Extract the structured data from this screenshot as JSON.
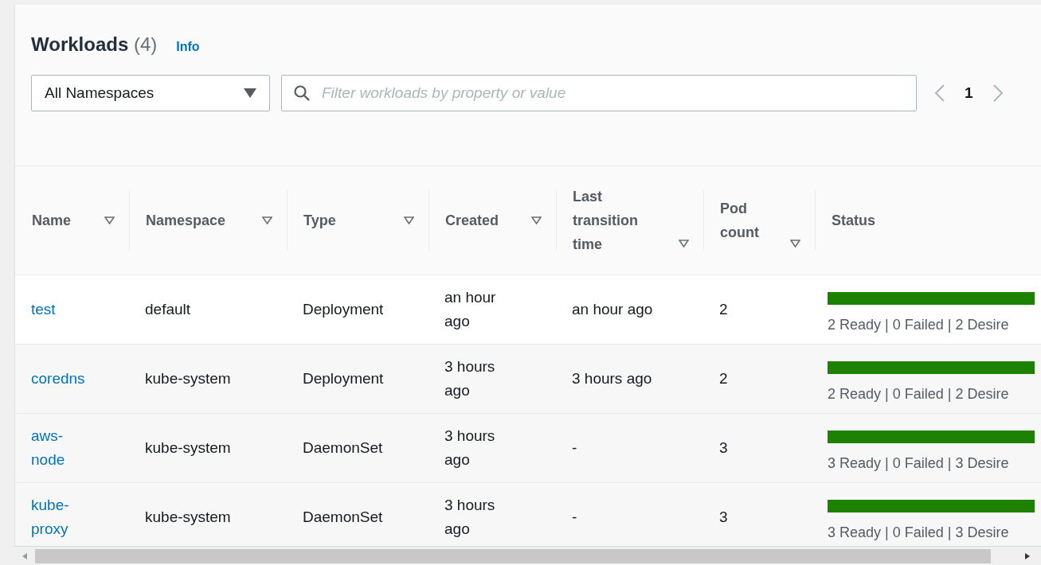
{
  "header": {
    "title": "Workloads",
    "count": "(4)",
    "info_link": "Info"
  },
  "namespace_select": {
    "value": "All Namespaces"
  },
  "search": {
    "placeholder": "Filter workloads by property or value"
  },
  "pagination": {
    "current_page": "1"
  },
  "table": {
    "columns": [
      {
        "label": "Name",
        "sortable": true
      },
      {
        "label": "Namespace",
        "sortable": true
      },
      {
        "label": "Type",
        "sortable": true
      },
      {
        "label": "Created",
        "sortable": true
      },
      {
        "label": "Last transition time",
        "sortable": true
      },
      {
        "label": "Pod count",
        "sortable": true
      },
      {
        "label": "Status",
        "sortable": false
      }
    ],
    "rows": [
      {
        "name": "test",
        "namespace": "default",
        "type": "Deployment",
        "created": "an hour ago",
        "last_transition": "an hour ago",
        "pod_count": "2",
        "level": 1,
        "status": "2 Ready | 0 Failed | 2 Desire"
      },
      {
        "name": "coredns",
        "namespace": "kube-system",
        "type": "Deployment",
        "created": "3 hours ago",
        "last_transition": "3 hours ago",
        "pod_count": "2",
        "level": 1,
        "status": "2 Ready | 0 Failed | 2 Desire"
      },
      {
        "name": "aws-node",
        "namespace": "kube-system",
        "type": "DaemonSet",
        "created": "3 hours ago",
        "last_transition": "-",
        "pod_count": "3",
        "level": 1,
        "status": "3 Ready | 0 Failed | 3 Desire"
      },
      {
        "name": "kube-proxy",
        "namespace": "kube-system",
        "type": "DaemonSet",
        "created": "3 hours ago",
        "last_transition": "-",
        "pod_count": "3",
        "level": 1,
        "status": "3 Ready | 0 Failed | 3 Desire"
      }
    ]
  }
}
